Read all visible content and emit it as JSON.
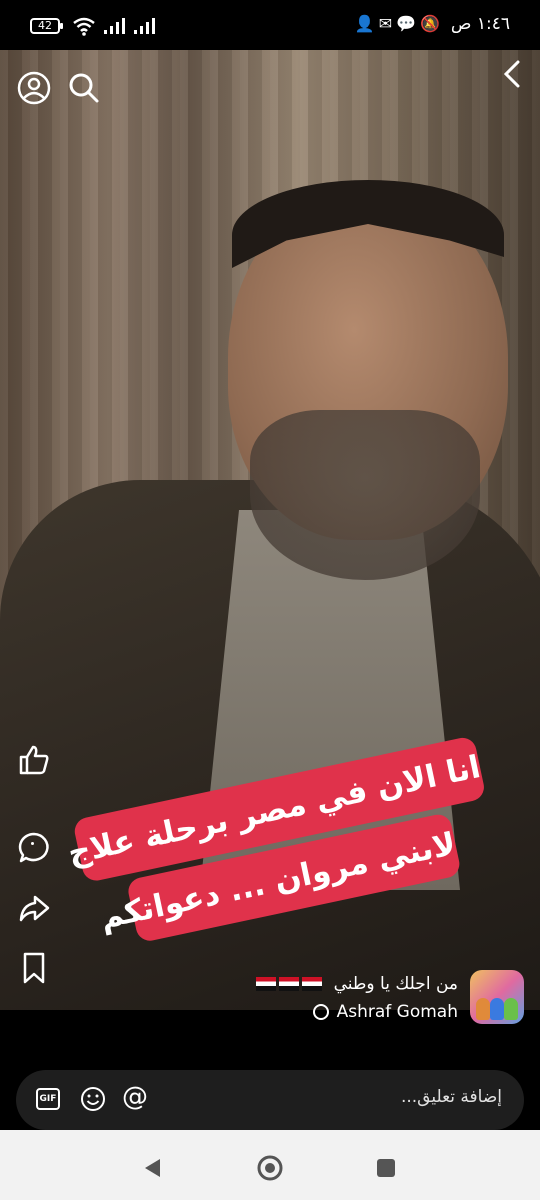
{
  "status_bar": {
    "time": "١:٤٦ ص",
    "battery": "42",
    "notification_icons": [
      "mute-icon",
      "messenger-icon",
      "chat-icon",
      "person-icon"
    ]
  },
  "video": {
    "caption_line1": "انا الان في مصر برحلة علاج",
    "caption_line2": "لابني مروان ... دعواتكم"
  },
  "post": {
    "title": "من اجلك يا وطني",
    "author": "Ashraf Gomah",
    "flag_count": 3
  },
  "comment_bar": {
    "placeholder": "إضافة تعليق...",
    "gif_label": "GIF",
    "mention_label": "@"
  },
  "colors": {
    "caption_bg": "#e0324b",
    "nav_bg": "#f2f2f2",
    "input_bg": "#1e1e1e"
  }
}
